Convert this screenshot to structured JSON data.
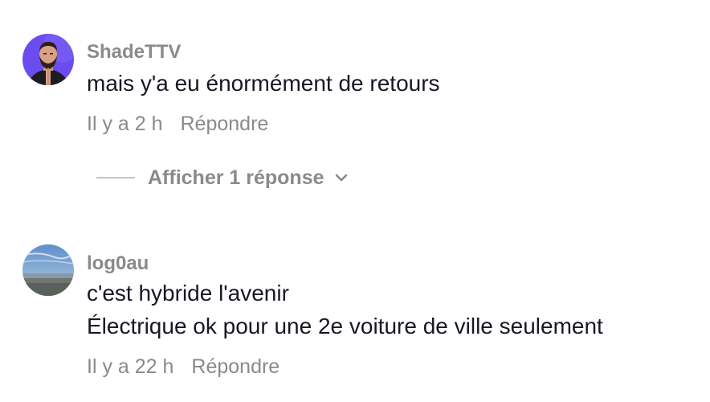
{
  "comments": [
    {
      "username": "ShadeTTV",
      "lines": [
        "mais y'a eu énormément de retours"
      ],
      "time": "Il y a 2 h",
      "reply_label": "Répondre",
      "avatar": "bearded-man-praying-avatar"
    },
    {
      "username": "log0au",
      "lines": [
        "c'est hybride l'avenir",
        "Électrique ok pour une 2e voiture de ville seulement"
      ],
      "time": "Il y a 22 h",
      "reply_label": "Répondre",
      "avatar": "seaside-landscape-avatar"
    }
  ],
  "view_replies": {
    "label": "Afficher 1 réponse",
    "icon": "chevron-down-icon"
  },
  "colors": {
    "text_primary": "#161823",
    "text_secondary": "#8a8a8a",
    "divider": "#c4c4c4"
  }
}
